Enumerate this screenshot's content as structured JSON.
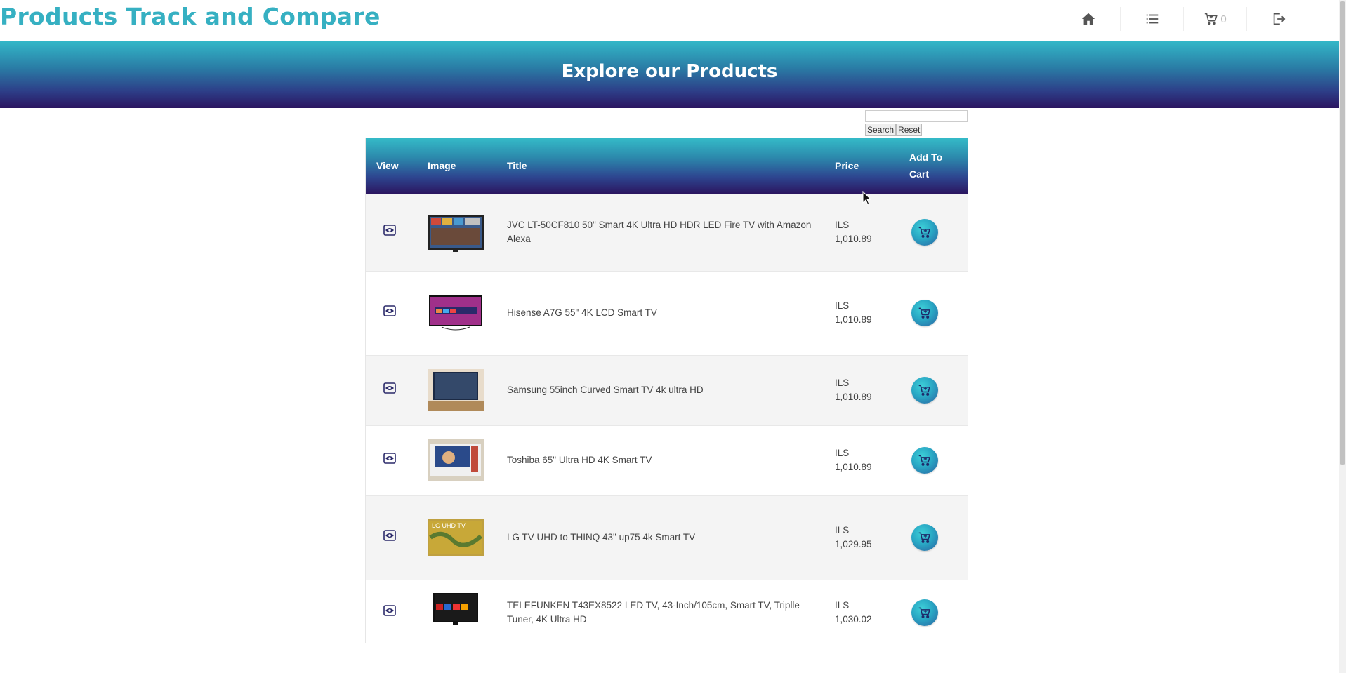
{
  "brand": "Products Track and Compare",
  "nav": {
    "home_icon": "home-icon",
    "list_icon": "list-icon",
    "cart_icon": "cart-icon",
    "cart_count": "0",
    "logout_icon": "logout-icon"
  },
  "hero": {
    "title": "Explore our Products"
  },
  "search": {
    "value": "",
    "search_label": "Search",
    "reset_label": "Reset"
  },
  "table": {
    "headers": {
      "view": "View",
      "image": "Image",
      "title": "Title",
      "price": "Price",
      "cart_line1": "Add To",
      "cart_line2": "Cart"
    },
    "rows": [
      {
        "title": "JVC LT-50CF810 50\" Smart 4K Ultra HD HDR LED Fire TV with Amazon Alexa",
        "currency": "ILS",
        "price": "1,010.89"
      },
      {
        "title": "Hisense A7G 55\" 4K LCD Smart TV",
        "currency": "ILS",
        "price": "1,010.89"
      },
      {
        "title": "Samsung 55inch Curved Smart TV 4k ultra HD",
        "currency": "ILS",
        "price": "1,010.89"
      },
      {
        "title": "Toshiba 65\" Ultra HD 4K Smart TV",
        "currency": "ILS",
        "price": "1,010.89"
      },
      {
        "title": "LG TV UHD to THINQ 43\" up75 4k Smart TV",
        "currency": "ILS",
        "price": "1,029.95"
      },
      {
        "title": "TELEFUNKEN T43EX8522 LED TV, 43-Inch/105cm, Smart TV, Triplle Tuner, 4K Ultra HD",
        "currency": "ILS",
        "price": "1,030.02"
      }
    ]
  },
  "colors": {
    "brand": "#36b0c2",
    "gradient_top": "#33b8c8",
    "gradient_bottom": "#2b1560"
  }
}
